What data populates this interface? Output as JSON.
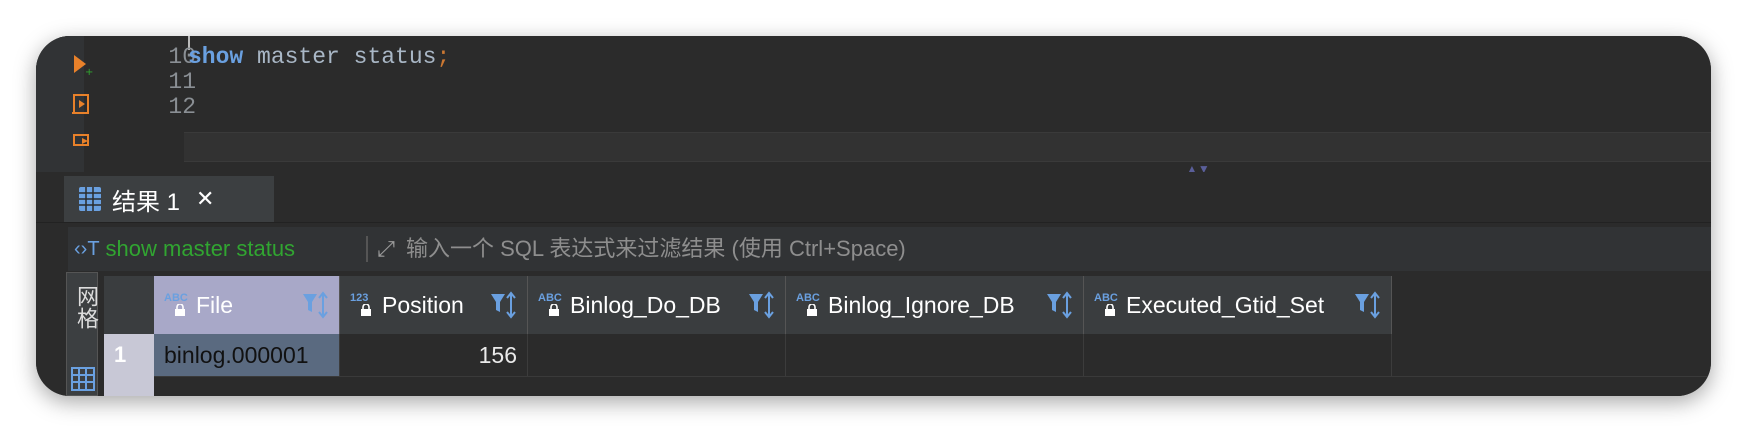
{
  "editor": {
    "line_numbers": [
      "10",
      "11",
      "12"
    ],
    "code_keyword": "show",
    "code_rest": " master status",
    "code_semicolon": ";"
  },
  "results": {
    "tab_label": "结果 1",
    "query_name": "show master status",
    "filter_placeholder": "输入一个 SQL 表达式来过滤结果 (使用 Ctrl+Space)",
    "side_tab_label": "网格",
    "columns": [
      {
        "name": "File",
        "type_icon": "ABC"
      },
      {
        "name": "Position",
        "type_icon": "123"
      },
      {
        "name": "Binlog_Do_DB",
        "type_icon": "ABC"
      },
      {
        "name": "Binlog_Ignore_DB",
        "type_icon": "ABC"
      },
      {
        "name": "Executed_Gtid_Set",
        "type_icon": "ABC"
      }
    ],
    "rows": [
      {
        "num": "1",
        "cells": [
          "binlog.000001",
          "156",
          "",
          "",
          ""
        ]
      }
    ]
  },
  "colors": {
    "accent": "#6aa0e0",
    "run_orange": "#e8812a",
    "query_green": "#31a531"
  }
}
